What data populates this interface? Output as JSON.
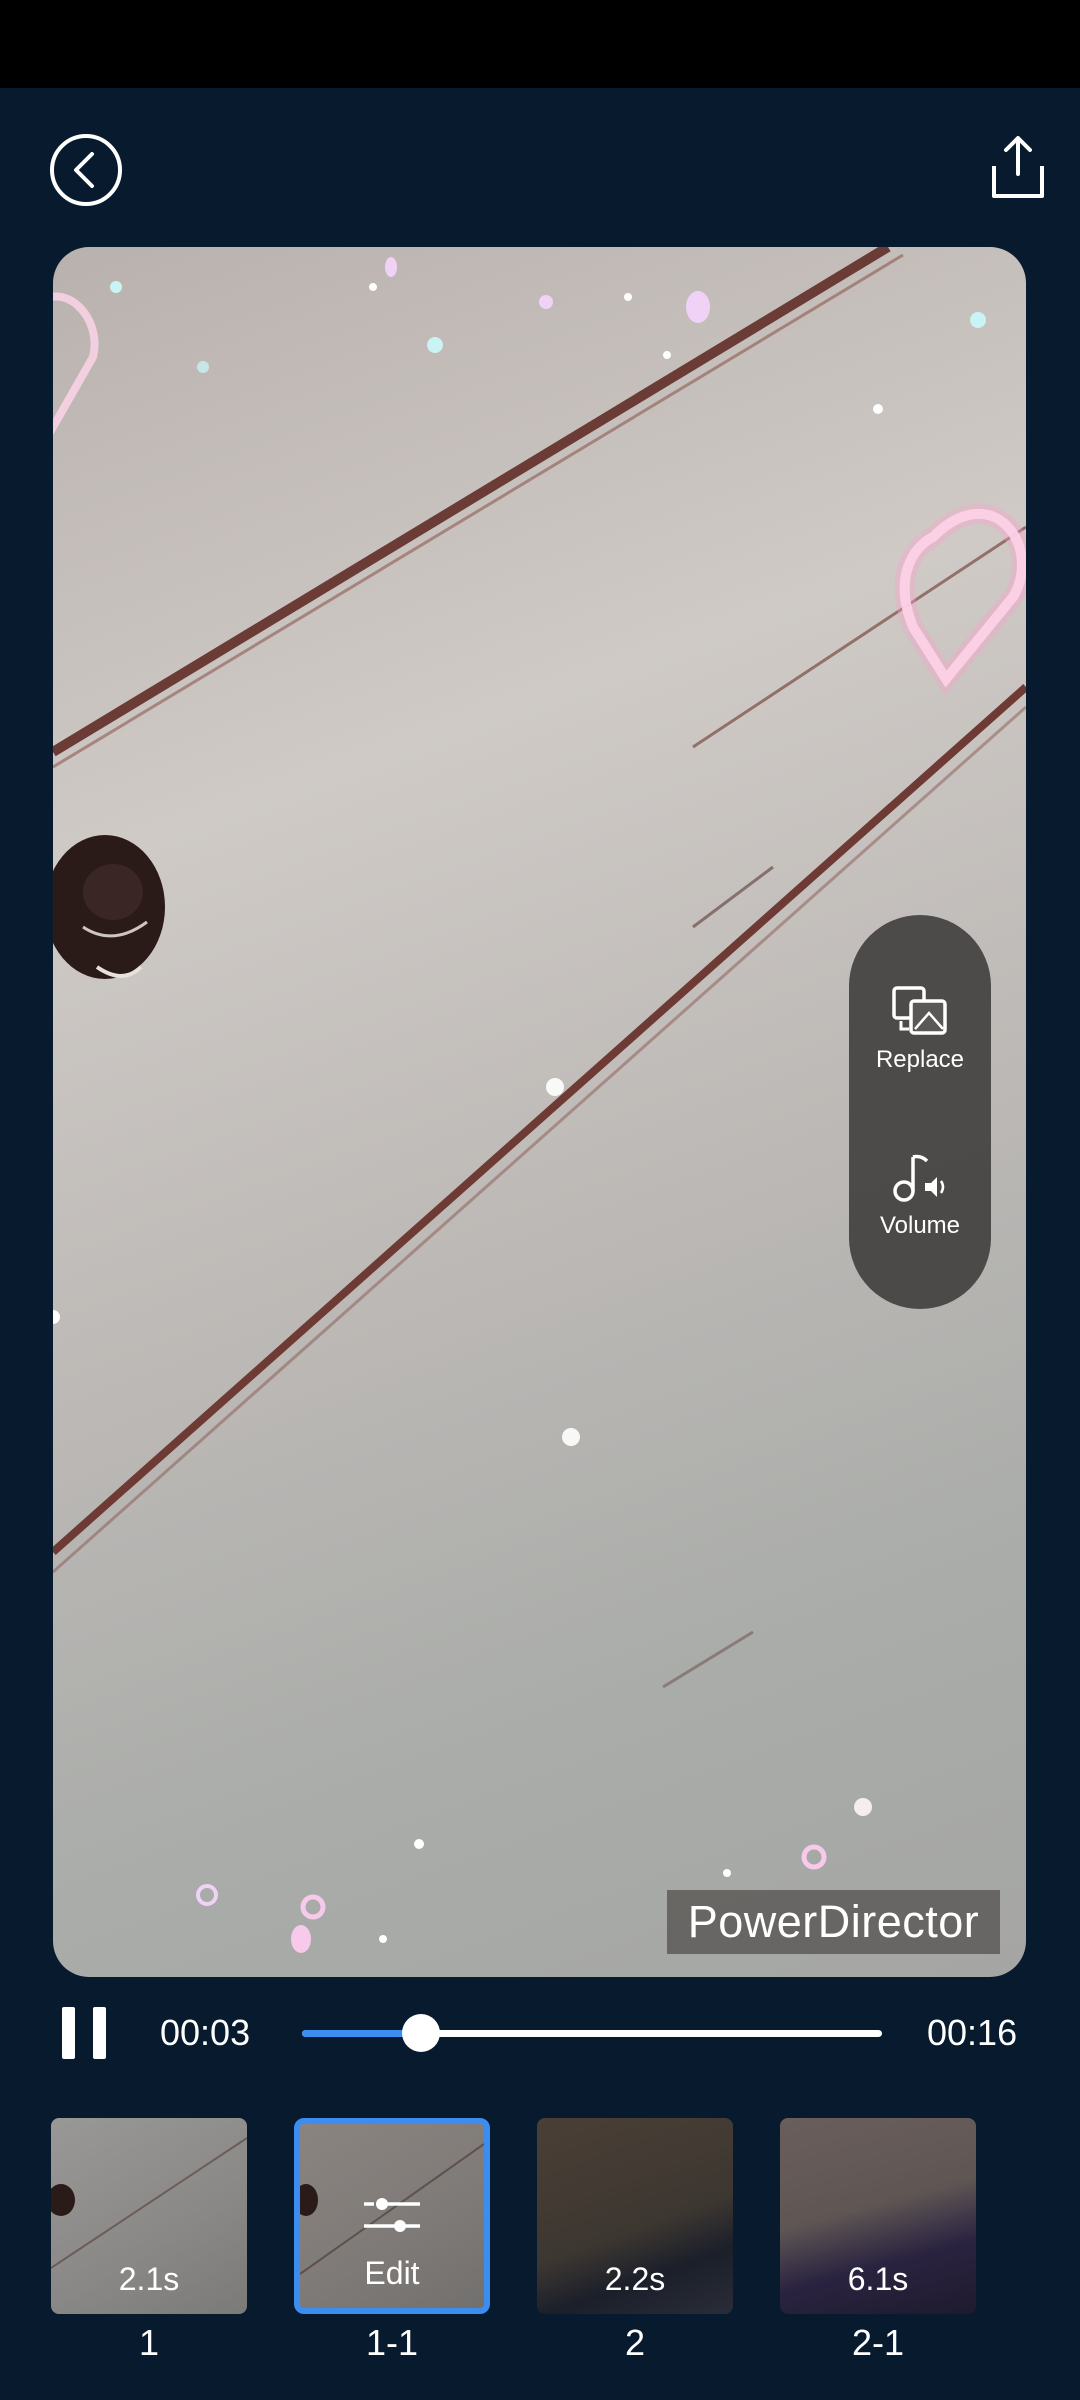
{
  "header": {
    "back_icon": "chevron-left-circle-icon",
    "share_icon": "share-upload-icon"
  },
  "preview": {
    "watermark": "PowerDirector"
  },
  "side_panel": {
    "replace_label": "Replace",
    "volume_label": "Volume"
  },
  "player": {
    "current_time": "00:03",
    "total_time": "00:16",
    "progress": 0.205,
    "state_icon": "pause-icon"
  },
  "clips": [
    {
      "duration": "2.1s",
      "label": "1",
      "selected": false
    },
    {
      "duration": "Edit",
      "label": "1-1",
      "selected": true
    },
    {
      "duration": "2.2s",
      "label": "2",
      "selected": false
    },
    {
      "duration": "6.1s",
      "label": "2-1",
      "selected": false
    }
  ],
  "colors": {
    "background": "#071a2e",
    "accent": "#3d8cf0"
  }
}
